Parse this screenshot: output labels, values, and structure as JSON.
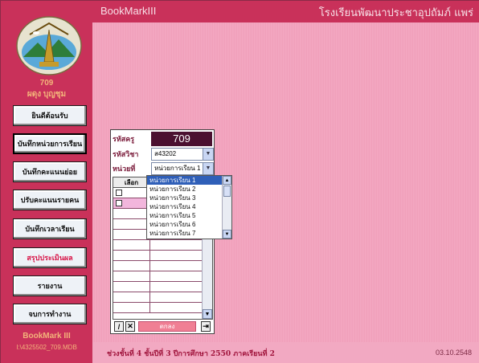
{
  "header": {
    "app_title": "BookMarkIII",
    "school_name": "โรงเรียนพัฒนาประชาอุปถัมภ์ แพร่"
  },
  "user": {
    "id": "709",
    "name": "ผดุง บุญชุม"
  },
  "sidebar": {
    "items": [
      {
        "label": "ยินดีต้อนรับ"
      },
      {
        "label": "บันทึกหน่วยการเรียน"
      },
      {
        "label": "บันทึกคะแนนย่อย"
      },
      {
        "label": "ปรับคะแนนรายคน"
      },
      {
        "label": "บันทึกเวลาเรียน"
      },
      {
        "label": "สรุปประเมินผล"
      },
      {
        "label": "รายงาน"
      },
      {
        "label": "จบการทำงาน"
      }
    ],
    "footer_title": "BookMark III",
    "footer_path": "I:\\4325502_709.MDB"
  },
  "form": {
    "teacher_code_label": "รหัสครู",
    "teacher_code": "709",
    "subject_code_label": "รหัสวิชา",
    "subject_code": "ส43202",
    "unit_label": "หน่วยที่",
    "unit_value": "หน่วยการเรียน 1",
    "select_column": "เลือก",
    "ok_label": "ตกลง"
  },
  "dropdown": {
    "options": [
      "หน่วยการเรียน 1",
      "หน่วยการเรียน 2",
      "หน่วยการเรียน 3",
      "หน่วยการเรียน 4",
      "หน่วยการเรียน 5",
      "หน่วยการเรียน 6",
      "หน่วยการเรียน 7"
    ]
  },
  "footer": {
    "info": "ช่วงชั้นที่ 4  ชั้นปีที่ 3  ปีการศึกษา 2550  ภาคเรียนที่ 2",
    "date": "03.10.2548"
  },
  "colors": {
    "header": "#c9315a",
    "sidebar": "#c9315a",
    "main_bg": "#f2a9c2",
    "accent_text": "#f3b37a"
  }
}
